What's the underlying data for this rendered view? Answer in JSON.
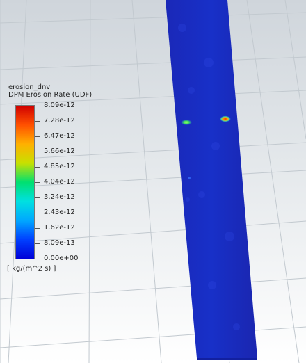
{
  "colorbar": {
    "variable": "erosion_dnv",
    "quantity": "DPM Erosion Rate (UDF)",
    "units": "[ kg/(m^2 s) ]",
    "ticks": [
      "8.09e-12",
      "7.28e-12",
      "6.47e-12",
      "5.66e-12",
      "4.85e-12",
      "4.04e-12",
      "3.24e-12",
      "2.43e-12",
      "1.62e-12",
      "8.09e-13",
      "0.00e+00"
    ],
    "min": 0,
    "max": 8.09e-12,
    "colors": [
      "#0000d8",
      "#0040ff",
      "#00a8ff",
      "#00e0e0",
      "#00e070",
      "#c8e000",
      "#ffb000",
      "#ff5000",
      "#d00000"
    ]
  },
  "pipe": {
    "base_color": "#1428c8"
  },
  "hotspots": [
    {
      "name": "green-hotspot",
      "color": "#40e060"
    },
    {
      "name": "red-hotspot",
      "color": "#ff3000"
    }
  ]
}
